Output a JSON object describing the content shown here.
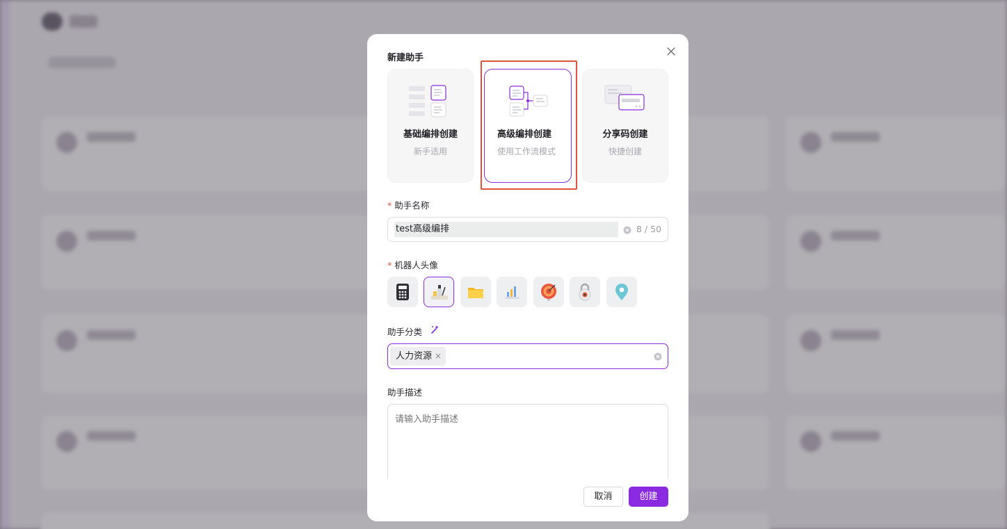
{
  "modal": {
    "title": "新建助手",
    "modes": [
      {
        "title": "基础编排创建",
        "subtitle": "新手适用",
        "icon": "basic-layout-icon",
        "selected": false
      },
      {
        "title": "高级编排创建",
        "subtitle": "使用工作流模式",
        "icon": "workflow-icon",
        "selected": true
      },
      {
        "title": "分享码创建",
        "subtitle": "快捷创建",
        "icon": "share-code-icon",
        "selected": false
      }
    ],
    "name_field": {
      "required_mark": "*",
      "label": "助手名称",
      "value": "test高级编排",
      "counter": "8 / 50"
    },
    "avatar_field": {
      "required_mark": "*",
      "label": "机器人头像",
      "options": [
        "calculator-icon",
        "desk-lamp-icon",
        "folder-icon",
        "bar-chart-icon",
        "target-icon",
        "padlock-icon",
        "map-pin-icon"
      ],
      "selected_index": 1
    },
    "category_field": {
      "label": "助手分类",
      "tags": [
        "人力资源"
      ],
      "tag_remove": "×"
    },
    "description_field": {
      "label": "助手描述",
      "placeholder": "请输入助手描述"
    },
    "buttons": {
      "cancel": "取消",
      "create": "创建"
    }
  },
  "colors": {
    "accent": "#8a2be2",
    "highlight": "#e2513c",
    "required": "#e2513c"
  }
}
